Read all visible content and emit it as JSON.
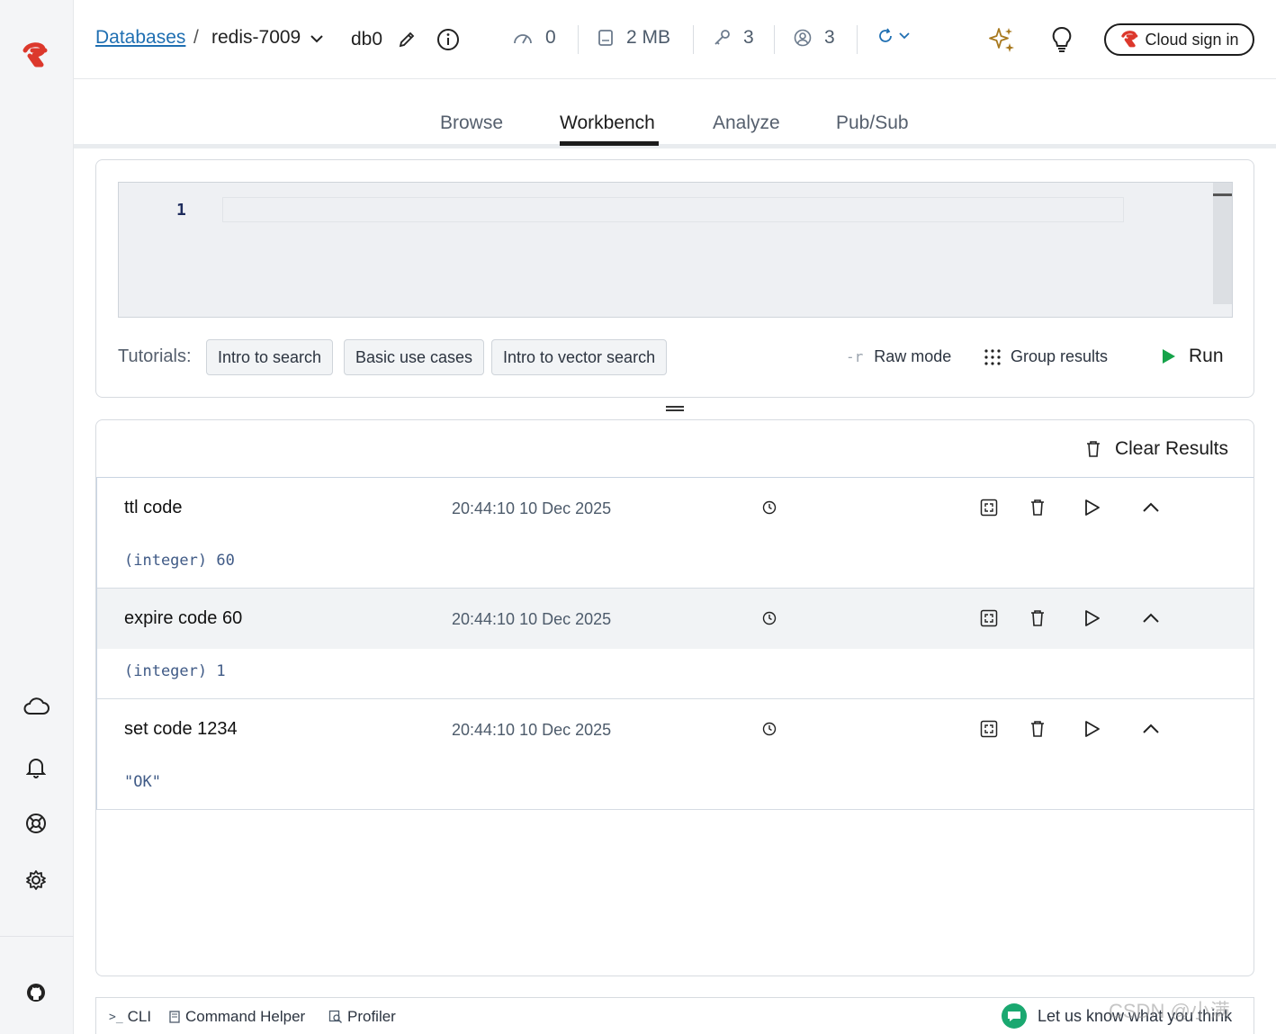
{
  "header": {
    "breadcrumb_root": "Databases",
    "breadcrumb_sep": "/",
    "instance_name": "redis-7009",
    "db_name": "db0",
    "stats": {
      "ops": "0",
      "memory": "2 MB",
      "keys": "3",
      "clients": "3"
    },
    "cloud_signin_label": "Cloud sign in"
  },
  "tabs": [
    {
      "label": "Browse",
      "active": false
    },
    {
      "label": "Workbench",
      "active": true
    },
    {
      "label": "Analyze",
      "active": false
    },
    {
      "label": "Pub/Sub",
      "active": false
    }
  ],
  "editor": {
    "line_number": "1",
    "content": ""
  },
  "tutorials": {
    "label": "Tutorials:",
    "items": [
      "Intro to search",
      "Basic use cases",
      "Intro to vector search"
    ]
  },
  "toolbar": {
    "raw_mode_icon": "-r",
    "raw_mode_label": "Raw mode",
    "group_results_label": "Group results",
    "run_label": "Run"
  },
  "results": {
    "clear_label": "Clear Results",
    "items": [
      {
        "command": "ttl code",
        "timestamp": "20:44:10 10 Dec 2025",
        "output": "(integer) 60"
      },
      {
        "command": "expire code 60",
        "timestamp": "20:44:10 10 Dec 2025",
        "output": "(integer) 1"
      },
      {
        "command": "set code 1234",
        "timestamp": "20:44:10 10 Dec 2025",
        "output": "\"OK\""
      }
    ]
  },
  "bottom": {
    "cli_label": "CLI",
    "command_helper_label": "Command Helper",
    "profiler_label": "Profiler",
    "feedback_label": "Let us know what you think"
  },
  "watermark": "CSDN @小满",
  "colors": {
    "brand_red": "#dc382c",
    "link_blue": "#1f6fb2",
    "run_green": "#16a34a",
    "feedback_green": "#1aa870"
  }
}
